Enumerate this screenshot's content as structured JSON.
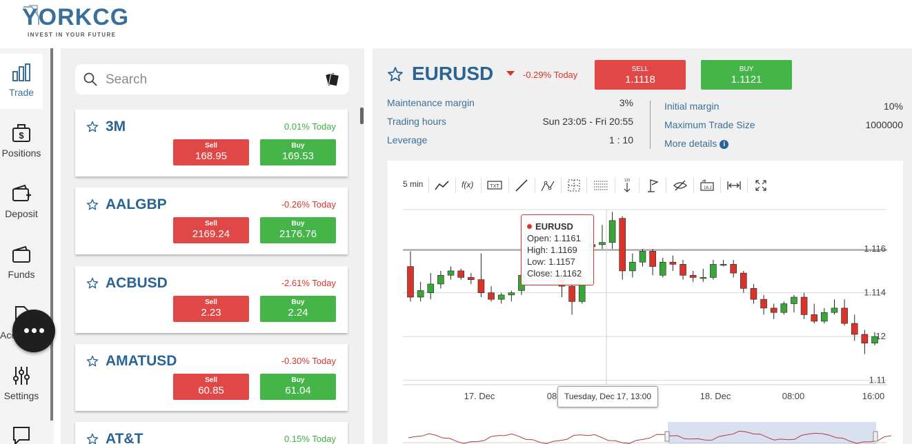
{
  "brand": {
    "logo_text": "YORKCG",
    "tagline": "INVEST IN YOUR FUTURE"
  },
  "nav": [
    {
      "label": "Trade",
      "icon": "bar-chart-icon",
      "active": true
    },
    {
      "label": "Positions",
      "icon": "briefcase-dollar-icon"
    },
    {
      "label": "Deposit",
      "icon": "wallet-plus-icon"
    },
    {
      "label": "Funds",
      "icon": "wallet-icon"
    },
    {
      "label": "Acc",
      "icon": "document-icon"
    },
    {
      "label": "Settings",
      "icon": "sliders-icon"
    },
    {
      "label": "",
      "icon": "chat-square-icon"
    }
  ],
  "search": {
    "placeholder": "Search"
  },
  "instruments": [
    {
      "symbol": "3M",
      "change": "0.01%",
      "today": "Today",
      "dir": "up",
      "sell_label": "Sell",
      "sell": "168.95",
      "buy_label": "Buy",
      "buy": "169.53"
    },
    {
      "symbol": "AALGBP",
      "change": "-0.26%",
      "today": "Today",
      "dir": "down",
      "sell_label": "Sell",
      "sell": "2169.24",
      "buy_label": "Buy",
      "buy": "2176.76"
    },
    {
      "symbol": "ACBUSD",
      "change": "-2.61%",
      "today": "Today",
      "dir": "down",
      "sell_label": "Sell",
      "sell": "2.23",
      "buy_label": "Buy",
      "buy": "2.24"
    },
    {
      "symbol": "AMATUSD",
      "change": "-0.30%",
      "today": "Today",
      "dir": "down",
      "sell_label": "Sell",
      "sell": "60.85",
      "buy_label": "Buy",
      "buy": "61.04"
    },
    {
      "symbol": "AT&T",
      "change": "0.15%",
      "today": "Today",
      "dir": "up"
    }
  ],
  "detail": {
    "symbol": "EURUSD",
    "change": "-0.29%",
    "today": "Today",
    "sell_label": "SELL",
    "sell": "1.1118",
    "buy_label": "BUY",
    "buy": "1.1121",
    "left_info": [
      {
        "label": "Maintenance margin",
        "value": "3%"
      },
      {
        "label": "Trading hours",
        "value": "Sun 23:05 - Fri 20:55"
      },
      {
        "label": "Leverage",
        "value": "1 : 10"
      }
    ],
    "right_info": [
      {
        "label": "Initial margin",
        "value": "10%"
      },
      {
        "label": "Maximum Trade Size",
        "value": "1000000"
      }
    ],
    "more_details": "More details"
  },
  "chart_toolbar": {
    "interval": "5 min",
    "tools": [
      "line-chart-icon",
      "function-icon",
      "text-icon",
      "trend-line-icon",
      "pattern-icon",
      "crosshair-icon",
      "fibonacci-icon",
      "measure-icon",
      "flag-icon",
      "eye-hide-icon",
      "price-label-icon",
      "zoom-range-icon",
      "fullscreen-icon"
    ],
    "fx_label": "f(x)"
  },
  "chart_data": {
    "type": "candlestick",
    "series": [
      {
        "name": "EURUSD"
      }
    ],
    "ylim": [
      1.1098,
      1.1178
    ],
    "y_ticks": [
      "1.116",
      "1.114",
      "12",
      "1.11"
    ],
    "x_ticks": [
      "17. Dec",
      "08",
      "18. Dec",
      "08:00",
      "16:00"
    ],
    "candles": [
      [
        1.1152,
        1.1159,
        1.1136,
        1.1138
      ],
      [
        1.1138,
        1.1145,
        1.1136,
        1.1141
      ],
      [
        1.114,
        1.1149,
        1.1137,
        1.1144
      ],
      [
        1.1144,
        1.115,
        1.1142,
        1.1148
      ],
      [
        1.1148,
        1.1152,
        1.1146,
        1.115
      ],
      [
        1.115,
        1.1151,
        1.1146,
        1.1147
      ],
      [
        1.1147,
        1.1149,
        1.1144,
        1.1146
      ],
      [
        1.1146,
        1.1158,
        1.1138,
        1.114
      ],
      [
        1.114,
        1.1143,
        1.1136,
        1.1137
      ],
      [
        1.1137,
        1.114,
        1.1135,
        1.1139
      ],
      [
        1.1139,
        1.1141,
        1.1136,
        1.114
      ],
      [
        1.1141,
        1.1153,
        1.1139,
        1.1148
      ],
      [
        1.1148,
        1.1153,
        1.1146,
        1.115
      ],
      [
        1.115,
        1.1152,
        1.1148,
        1.1149
      ],
      [
        1.1149,
        1.1151,
        1.1146,
        1.1147
      ],
      [
        1.1147,
        1.1151,
        1.1138,
        1.1143
      ],
      [
        1.1143,
        1.1146,
        1.113,
        1.1136
      ],
      [
        1.1136,
        1.1148,
        1.1135,
        1.1147
      ],
      [
        1.1161,
        1.1169,
        1.1157,
        1.1162
      ],
      [
        1.1162,
        1.1171,
        1.116,
        1.1163
      ],
      [
        1.1163,
        1.1177,
        1.116,
        1.1173
      ],
      [
        1.1174,
        1.1175,
        1.1146,
        1.115
      ],
      [
        1.115,
        1.1158,
        1.1147,
        1.1154
      ],
      [
        1.1154,
        1.116,
        1.1152,
        1.1159
      ],
      [
        1.1159,
        1.116,
        1.1148,
        1.1152
      ],
      [
        1.1148,
        1.1156,
        1.1147,
        1.1154
      ],
      [
        1.1154,
        1.1157,
        1.115,
        1.1153
      ],
      [
        1.1153,
        1.1155,
        1.1146,
        1.1148
      ],
      [
        1.1148,
        1.115,
        1.1145,
        1.1147
      ],
      [
        1.1147,
        1.1151,
        1.1145,
        1.1147
      ],
      [
        1.1147,
        1.1155,
        1.1146,
        1.1153
      ],
      [
        1.1153,
        1.1155,
        1.1152,
        1.1153
      ],
      [
        1.1153,
        1.1155,
        1.1147,
        1.1149
      ],
      [
        1.1149,
        1.115,
        1.114,
        1.1142
      ],
      [
        1.1142,
        1.1144,
        1.1135,
        1.1137
      ],
      [
        1.1137,
        1.1139,
        1.113,
        1.1133
      ],
      [
        1.1133,
        1.1135,
        1.1128,
        1.1131
      ],
      [
        1.1131,
        1.1136,
        1.113,
        1.1135
      ],
      [
        1.1135,
        1.1139,
        1.1131,
        1.1138
      ],
      [
        1.1138,
        1.114,
        1.1128,
        1.113
      ],
      [
        1.113,
        1.1135,
        1.1126,
        1.1127
      ],
      [
        1.1127,
        1.1133,
        1.1126,
        1.1131
      ],
      [
        1.1131,
        1.1137,
        1.113,
        1.1133
      ],
      [
        1.1133,
        1.1137,
        1.1125,
        1.1126
      ],
      [
        1.1126,
        1.113,
        1.1118,
        1.1121
      ],
      [
        1.1121,
        1.1123,
        1.1112,
        1.1117
      ],
      [
        1.1117,
        1.1122,
        1.1116,
        1.112
      ]
    ],
    "tooltip": {
      "title": "EURUSD",
      "open": "Open: 1.1161",
      "high": "High: 1.1169",
      "low": "Low: 1.1157",
      "close": "Close: 1.1162"
    },
    "x_tooltip": "Tuesday, Dec 17, 13:00",
    "up_color": "#3aa63a",
    "down_color": "#d9342b"
  }
}
